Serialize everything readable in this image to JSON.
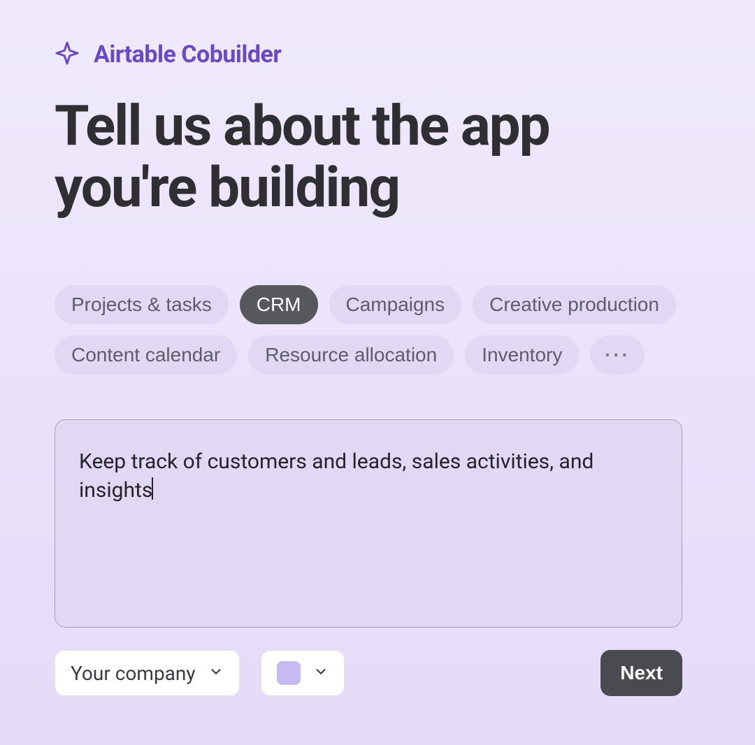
{
  "brand": {
    "label": "Airtable Cobuilder"
  },
  "title": "Tell us about the app you're building",
  "chips": [
    {
      "label": "Projects & tasks",
      "active": false
    },
    {
      "label": "CRM",
      "active": true
    },
    {
      "label": "Campaigns",
      "active": false
    },
    {
      "label": "Creative production",
      "active": false
    },
    {
      "label": "Content calendar",
      "active": false
    },
    {
      "label": "Resource allocation",
      "active": false
    },
    {
      "label": "Inventory",
      "active": false
    }
  ],
  "more_label": "···",
  "prompt_value": "Keep track of customers and leads, sales activities, and insights",
  "company_select": {
    "label": "Your company"
  },
  "color_swatch": "#c7b9f2",
  "next_label": "Next"
}
